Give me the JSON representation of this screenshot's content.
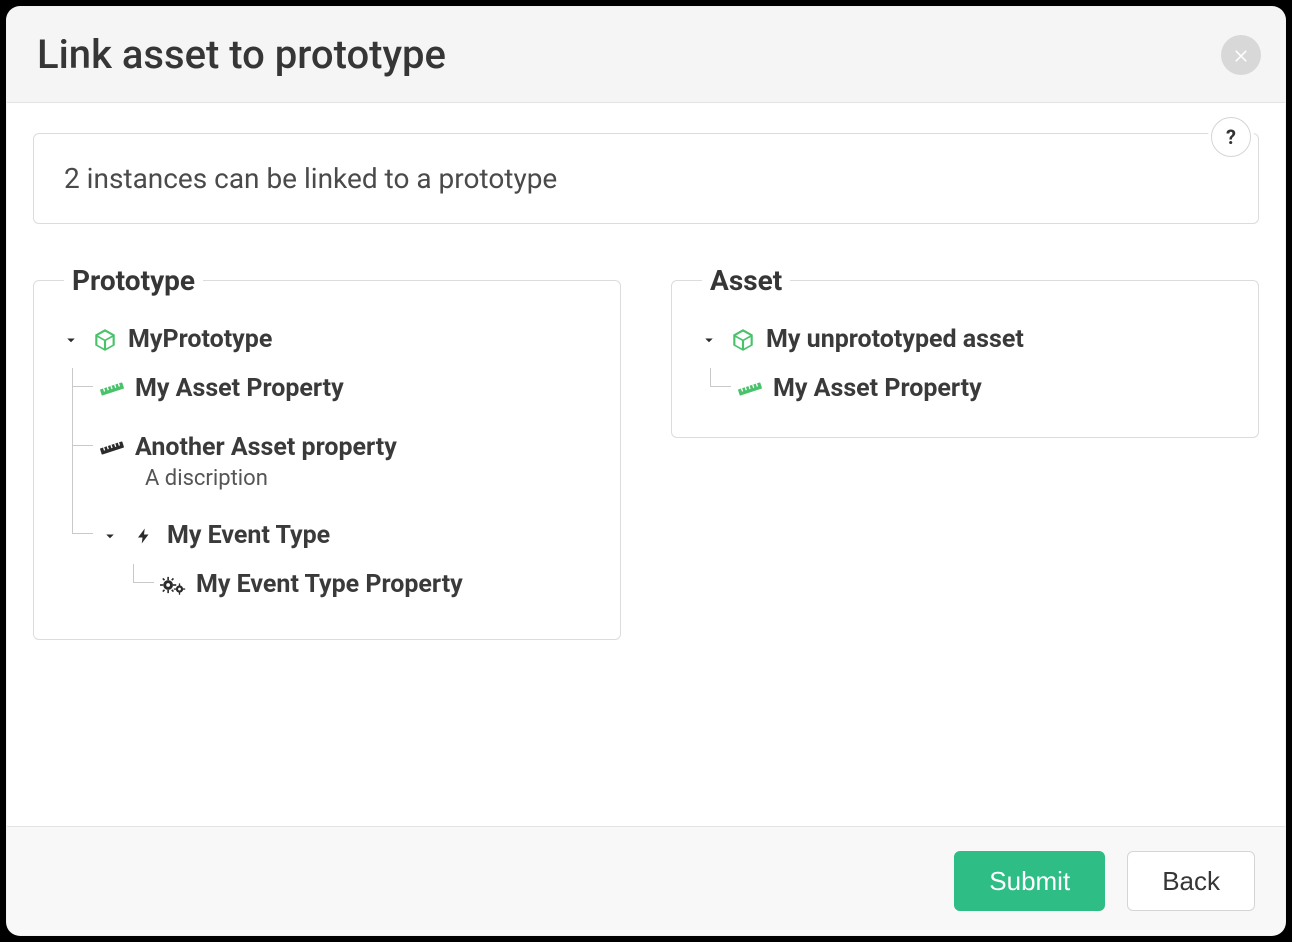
{
  "modal": {
    "title": "Link asset to prototype",
    "notice": "2 instances can be linked to a prototype",
    "help_label": "?"
  },
  "prototype": {
    "legend": "Prototype",
    "root": {
      "label": "MyPrototype",
      "children": [
        {
          "label": "My Asset Property",
          "icon": "ruler-green"
        },
        {
          "label": "Another Asset property",
          "icon": "ruler-dark",
          "description": "A discription"
        },
        {
          "label": "My Event Type",
          "icon": "bolt",
          "children": [
            {
              "label": "My Event Type Property",
              "icon": "gears"
            }
          ]
        }
      ]
    }
  },
  "asset": {
    "legend": "Asset",
    "root": {
      "label": "My unprototyped asset",
      "children": [
        {
          "label": "My Asset Property",
          "icon": "ruler-green"
        }
      ]
    }
  },
  "footer": {
    "submit": "Submit",
    "back": "Back"
  },
  "colors": {
    "primary": "#2ebd85",
    "icon_green": "#4ac26b",
    "icon_dark": "#2b2b2b"
  }
}
